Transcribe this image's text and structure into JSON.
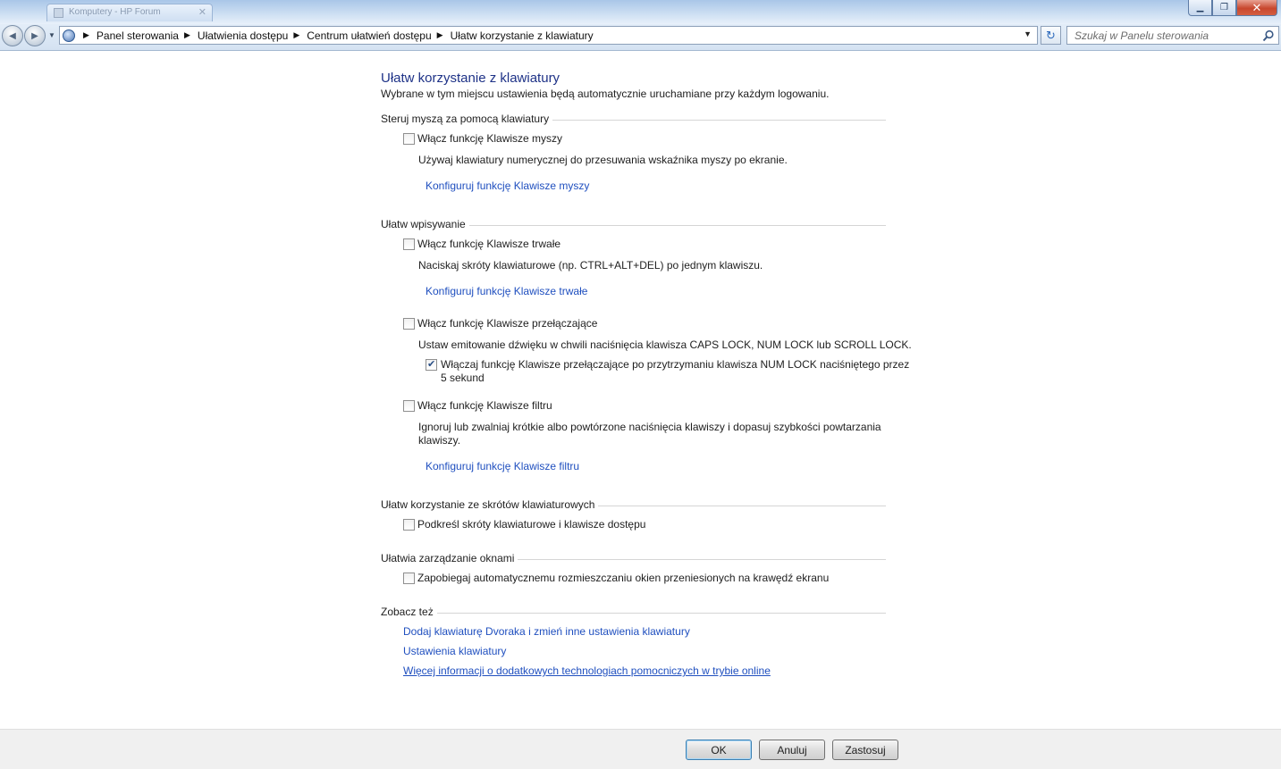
{
  "window": {
    "tab_title": "Komputery - HP Forum",
    "minimize_glyph": "▁",
    "restore_glyph": "❐",
    "close_glyph": "✕"
  },
  "navigation": {
    "back_glyph": "◀",
    "forward_glyph": "▶",
    "breadcrumbs": [
      "Panel sterowania",
      "Ułatwienia dostępu",
      "Centrum ułatwień dostępu",
      "Ułatw korzystanie z klawiatury"
    ],
    "refresh_glyph": "↻",
    "search_placeholder": "Szukaj w Panelu sterowania"
  },
  "page": {
    "title": "Ułatw korzystanie z klawiatury",
    "subtitle": "Wybrane w tym miejscu ustawienia będą automatycznie uruchamiane przy każdym logowaniu."
  },
  "sections": {
    "mouse": {
      "heading": "Steruj myszą za pomocą klawiatury",
      "checkbox_label": "Włącz funkcję Klawisze myszy",
      "checked": false,
      "description": "Używaj klawiatury numerycznej do przesuwania wskaźnika myszy po ekranie.",
      "link": "Konfiguruj funkcję Klawisze myszy"
    },
    "typing": {
      "heading": "Ułatw wpisywanie",
      "sticky": {
        "checkbox_label": "Włącz funkcję Klawisze trwałe",
        "checked": false,
        "description": "Naciskaj skróty klawiaturowe (np. CTRL+ALT+DEL) po jednym klawiszu.",
        "link": "Konfiguruj funkcję Klawisze trwałe"
      },
      "toggle": {
        "checkbox_label": "Włącz funkcję Klawisze przełączające",
        "checked": false,
        "description": "Ustaw emitowanie dźwięku w chwili naciśnięcia klawisza CAPS LOCK, NUM LOCK lub SCROLL LOCK.",
        "sub_checkbox_label_line1": "Włączaj funkcję Klawisze przełączające po przytrzymaniu klawisza NUM LOCK naciśniętego przez",
        "sub_checkbox_label_line2": "5 sekund",
        "sub_checked": true
      },
      "filter": {
        "checkbox_label": "Włącz funkcję Klawisze filtru",
        "checked": false,
        "description_line1": "Ignoruj lub zwalniaj krótkie albo powtórzone naciśnięcia klawiszy i dopasuj szybkości powtarzania",
        "description_line2": "klawiszy.",
        "link": "Konfiguruj funkcję Klawisze filtru"
      }
    },
    "shortcuts": {
      "heading": "Ułatw korzystanie ze skrótów klawiaturowych",
      "checkbox_label": "Podkreśl skróty klawiaturowe i klawisze dostępu",
      "checked": false
    },
    "windows": {
      "heading": "Ułatwia zarządzanie oknami",
      "checkbox_label": "Zapobiegaj automatycznemu rozmieszczaniu okien przeniesionych na krawędź ekranu",
      "checked": false
    },
    "see_also": {
      "heading": "Zobacz też",
      "links": [
        "Dodaj klawiaturę Dvoraka i zmień inne ustawienia klawiatury",
        "Ustawienia klawiatury",
        "Więcej informacji o dodatkowych technologiach pomocniczych w trybie online"
      ]
    }
  },
  "footer": {
    "ok": "OK",
    "cancel": "Anuluj",
    "apply": "Zastosuj"
  }
}
